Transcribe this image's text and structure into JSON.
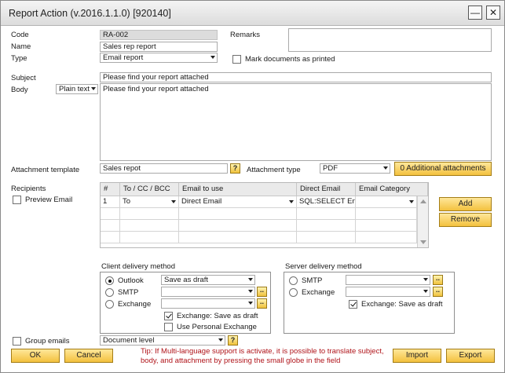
{
  "window": {
    "title": "Report Action (v.2016.1.1.0) [920140]"
  },
  "header": {
    "code_label": "Code",
    "code_value": "RA-002",
    "name_label": "Name",
    "name_value": "Sales rep report",
    "type_label": "Type",
    "type_value": "Email report",
    "remarks_label": "Remarks",
    "remarks_value": "",
    "mark_label": "Mark documents as printed"
  },
  "email": {
    "subject_label": "Subject",
    "subject_value": "Please find your report attached",
    "body_label": "Body",
    "body_format": "Plain text",
    "body_value": "Please find your report attached"
  },
  "attachment": {
    "template_label": "Attachment template",
    "template_value": "Sales repot",
    "help_symbol": "?",
    "type_label": "Attachment type",
    "type_value": "PDF",
    "additional_button": "0 Additional attachments"
  },
  "recipients": {
    "label": "Recipients",
    "preview_label": "Preview Email",
    "columns": [
      "#",
      "To / CC / BCC",
      "Email to use",
      "Direct Email",
      "Email Category"
    ],
    "rows": [
      {
        "num": "1",
        "to": "To",
        "email_to_use": "Direct Email",
        "direct_email": "SQL:SELECT En",
        "category": ""
      }
    ],
    "add_button": "Add",
    "remove_button": "Remove"
  },
  "client_delivery": {
    "title": "Client delivery method",
    "outlook_label": "Outlook",
    "outlook_value": "Save as draft",
    "smtp_label": "SMTP",
    "smtp_value": "",
    "exchange_label": "Exchange",
    "exchange_value": "",
    "dots": "..",
    "save_draft_label": "Exchange: Save as draft",
    "personal_exchange_label": "Use Personal Exchange"
  },
  "server_delivery": {
    "title": "Server delivery method",
    "smtp_label": "SMTP",
    "smtp_value": "",
    "exchange_label": "Exchange",
    "exchange_value": "",
    "dots": "..",
    "save_draft_label": "Exchange: Save as draft"
  },
  "grouping": {
    "label": "Group emails",
    "level_value": "Document level",
    "help_symbol": "?"
  },
  "footer": {
    "ok": "OK",
    "cancel": "Cancel",
    "import": "Import",
    "export": "Export",
    "tip": "Tip: If Multi-language support is activate, it is possible to translate subject, body, and attachment by pressing the small globe in the field"
  },
  "colors": {
    "accent": "#f3c13e",
    "tip": "#b0141a"
  },
  "icons": {
    "minimize": "minimize-icon",
    "maximize": "maximize-icon",
    "close": "close-icon"
  }
}
